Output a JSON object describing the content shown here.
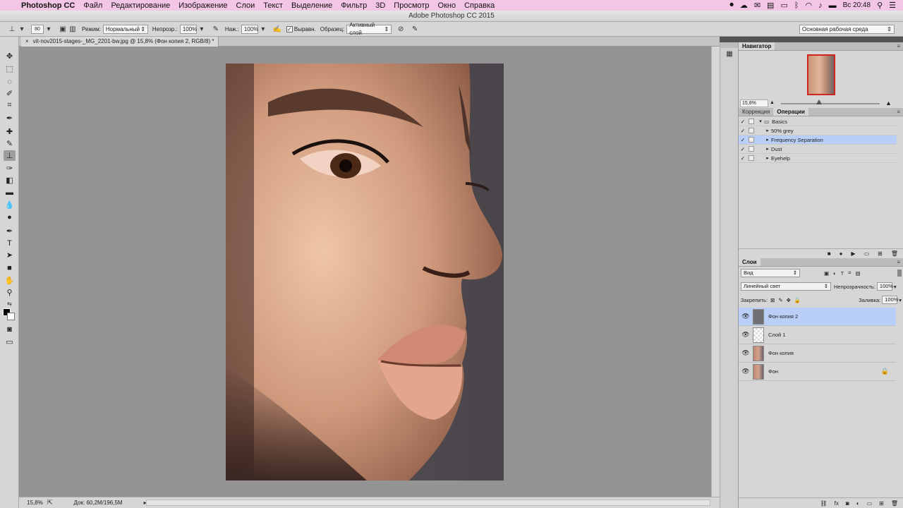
{
  "menubar": {
    "app_name": "Photoshop CC",
    "items": [
      "Файл",
      "Редактирование",
      "Изображение",
      "Слои",
      "Текст",
      "Выделение",
      "Фильтр",
      "3D",
      "Просмотр",
      "Окно",
      "Справка"
    ],
    "clock": "Вс 20:48"
  },
  "window": {
    "title": "Adobe Photoshop CC 2015"
  },
  "options": {
    "brush_size": "80",
    "mode_label": "Режим:",
    "mode_value": "Нормальный",
    "opacity_label": "Непрозр.:",
    "opacity_value": "100%",
    "flow_label": "Наж.:",
    "flow_value": "100%",
    "aligned_label": "Выравн.",
    "sample_label": "Образец:",
    "sample_value": "Активный слой",
    "workspace": "Основная рабочая среда"
  },
  "document": {
    "tab_title": "vit-nov2015-stages-_MG_2201-bw.jpg @ 15,8% (Фон копия 2, RGB/8) *",
    "zoom": "15,8%",
    "doc_size": "Док: 60,2M/196,5M"
  },
  "navigator": {
    "tab": "Навигатор",
    "zoom": "15,8%"
  },
  "actions_panel": {
    "tabs": [
      "Коррекция",
      "Операции"
    ],
    "active_tab": "Операции",
    "items": [
      {
        "label": "Basics",
        "type": "set"
      },
      {
        "label": "50% grey",
        "type": "action"
      },
      {
        "label": "Frequency Separation",
        "type": "action",
        "selected": true
      },
      {
        "label": "Dust",
        "type": "action"
      },
      {
        "label": "Eyehelp",
        "type": "action"
      }
    ]
  },
  "layers_panel": {
    "tab": "Слои",
    "filter": "Вид",
    "blend_mode": "Линейный свет",
    "opacity_label": "Непрозрачность:",
    "opacity_value": "100%",
    "lock_label": "Закрепить:",
    "fill_label": "Заливка:",
    "fill_value": "100%",
    "layers": [
      {
        "name": "Фон копия 2",
        "selected": true,
        "thumb": "gray"
      },
      {
        "name": "Слой 1",
        "thumb": "transparent"
      },
      {
        "name": "Фон копия",
        "thumb": "photo"
      },
      {
        "name": "Фон",
        "thumb": "photo",
        "locked": true
      }
    ]
  }
}
